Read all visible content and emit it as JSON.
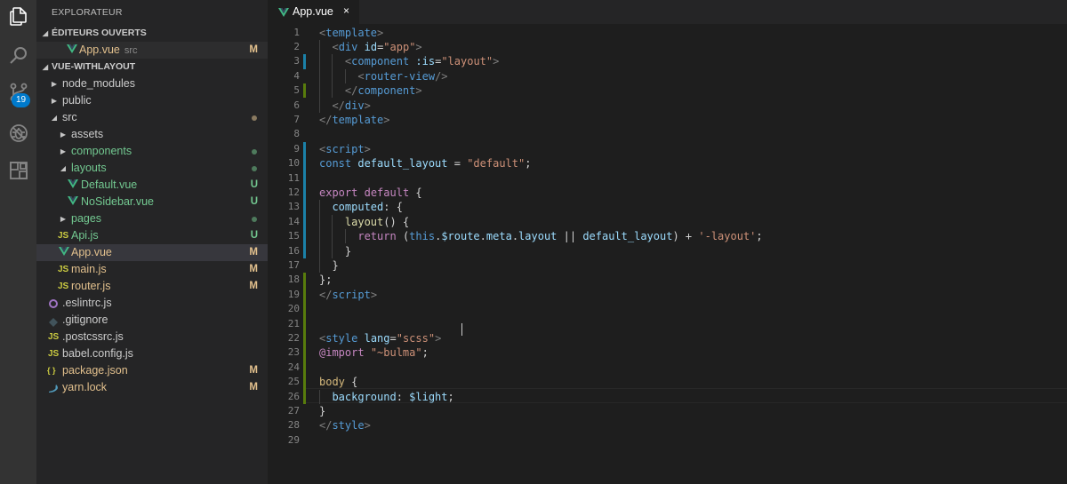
{
  "activity_bar": {
    "items": [
      {
        "name": "explorer-icon"
      },
      {
        "name": "search-icon"
      },
      {
        "name": "source-control-icon",
        "badge": "19"
      },
      {
        "name": "debug-icon"
      },
      {
        "name": "extensions-icon"
      }
    ],
    "active_color": "#ffffff",
    "inactive_color": "#858585"
  },
  "sidebar": {
    "title": "EXPLORATEUR",
    "open_editors": {
      "header": "ÉDITEURS OUVERTS",
      "items": [
        {
          "label": "App.vue",
          "description": "src",
          "status": "M"
        }
      ]
    },
    "project": {
      "header": "VUE-WITHLAYOUT",
      "items": [
        {
          "label": "node_modules",
          "kind": "folder",
          "expanded": false
        },
        {
          "label": "public",
          "kind": "folder",
          "expanded": false
        },
        {
          "label": "src",
          "kind": "folder",
          "expanded": true
        },
        {
          "label": "assets",
          "kind": "folder",
          "expanded": false
        },
        {
          "label": "components",
          "kind": "folder",
          "expanded": false
        },
        {
          "label": "layouts",
          "kind": "folder",
          "expanded": true
        },
        {
          "label": "Default.vue",
          "kind": "vue",
          "status": "U"
        },
        {
          "label": "NoSidebar.vue",
          "kind": "vue",
          "status": "U"
        },
        {
          "label": "pages",
          "kind": "folder",
          "expanded": false
        },
        {
          "label": "Api.js",
          "kind": "js",
          "icon_text": "JS",
          "status": "U"
        },
        {
          "label": "App.vue",
          "kind": "vue",
          "status": "M",
          "selected": true
        },
        {
          "label": "main.js",
          "kind": "js",
          "icon_text": "JS",
          "status": "M"
        },
        {
          "label": "router.js",
          "kind": "js",
          "icon_text": "JS",
          "status": "M"
        },
        {
          "label": ".eslintrc.js",
          "kind": "eslint"
        },
        {
          "label": ".gitignore",
          "kind": "git"
        },
        {
          "label": ".postcssrc.js",
          "kind": "js",
          "icon_text": "JS"
        },
        {
          "label": "babel.config.js",
          "kind": "js",
          "icon_text": "JS"
        },
        {
          "label": "package.json",
          "kind": "json",
          "icon_text": "{ }",
          "status": "M"
        },
        {
          "label": "yarn.lock",
          "kind": "yarn",
          "status": "M"
        }
      ]
    },
    "colors": {
      "modified": "#e2c08d",
      "untracked": "#73c991",
      "modified_dot": "#8a7a60",
      "untracked_dot": "#4e7a5c",
      "vue_green": "#41b883"
    }
  },
  "editor": {
    "tab": {
      "label": "App.vue",
      "close": "×"
    },
    "line_numbers": [
      "1",
      "2",
      "3",
      "4",
      "5",
      "6",
      "7",
      "8",
      "9",
      "10",
      "11",
      "12",
      "13",
      "14",
      "15",
      "16",
      "17",
      "18",
      "19",
      "20",
      "21",
      "22",
      "23",
      "24",
      "25",
      "26",
      "27",
      "28",
      "29"
    ],
    "lines": [
      [
        [
          "t-br",
          "<"
        ],
        [
          "t-tag",
          "template"
        ],
        [
          "t-br",
          ">"
        ]
      ],
      [
        [
          "t-pl",
          "  "
        ],
        [
          "t-br",
          "<"
        ],
        [
          "t-tag",
          "div"
        ],
        [
          "t-pl",
          " "
        ],
        [
          "t-attr",
          "id"
        ],
        [
          "t-pl",
          "="
        ],
        [
          "t-str",
          "\"app\""
        ],
        [
          "t-br",
          ">"
        ]
      ],
      [
        [
          "t-pl",
          "    "
        ],
        [
          "t-br",
          "<"
        ],
        [
          "t-tag",
          "component"
        ],
        [
          "t-pl",
          " "
        ],
        [
          "t-attr",
          ":is"
        ],
        [
          "t-pl",
          "="
        ],
        [
          "t-str",
          "\"layout\""
        ],
        [
          "t-br",
          ">"
        ]
      ],
      [
        [
          "t-pl",
          "      "
        ],
        [
          "t-br",
          "<"
        ],
        [
          "t-tag",
          "router-view"
        ],
        [
          "t-br",
          "/>"
        ]
      ],
      [
        [
          "t-pl",
          "    "
        ],
        [
          "t-br",
          "</"
        ],
        [
          "t-tag",
          "component"
        ],
        [
          "t-br",
          ">"
        ]
      ],
      [
        [
          "t-pl",
          "  "
        ],
        [
          "t-br",
          "</"
        ],
        [
          "t-tag",
          "div"
        ],
        [
          "t-br",
          ">"
        ]
      ],
      [
        [
          "t-br",
          "</"
        ],
        [
          "t-tag",
          "template"
        ],
        [
          "t-br",
          ">"
        ]
      ],
      [],
      [
        [
          "t-br",
          "<"
        ],
        [
          "t-tag",
          "script"
        ],
        [
          "t-br",
          ">"
        ]
      ],
      [
        [
          "t-kw2",
          "const"
        ],
        [
          "t-pl",
          " "
        ],
        [
          "t-var",
          "default_layout"
        ],
        [
          "t-pl",
          " = "
        ],
        [
          "t-str",
          "\"default\""
        ],
        [
          "t-pl",
          ";"
        ]
      ],
      [],
      [
        [
          "t-kw",
          "export"
        ],
        [
          "t-pl",
          " "
        ],
        [
          "t-kw",
          "default"
        ],
        [
          "t-pl",
          " {"
        ]
      ],
      [
        [
          "t-pl",
          "  "
        ],
        [
          "t-var",
          "computed"
        ],
        [
          "t-pl",
          ": {"
        ]
      ],
      [
        [
          "t-pl",
          "    "
        ],
        [
          "t-fn",
          "layout"
        ],
        [
          "t-pl",
          "() {"
        ]
      ],
      [
        [
          "t-pl",
          "      "
        ],
        [
          "t-kw",
          "return"
        ],
        [
          "t-pl",
          " ("
        ],
        [
          "t-kw2",
          "this"
        ],
        [
          "t-pl",
          "."
        ],
        [
          "t-var",
          "$route"
        ],
        [
          "t-pl",
          "."
        ],
        [
          "t-var",
          "meta"
        ],
        [
          "t-pl",
          "."
        ],
        [
          "t-var",
          "layout"
        ],
        [
          "t-pl",
          " || "
        ],
        [
          "t-var",
          "default_layout"
        ],
        [
          "t-pl",
          ") + "
        ],
        [
          "t-str",
          "'-layout'"
        ],
        [
          "t-pl",
          ";"
        ]
      ],
      [
        [
          "t-pl",
          "    }"
        ]
      ],
      [
        [
          "t-pl",
          "  }"
        ]
      ],
      [
        [
          "t-pl",
          "};"
        ]
      ],
      [
        [
          "t-br",
          "</"
        ],
        [
          "t-tag",
          "script"
        ],
        [
          "t-br",
          ">"
        ]
      ],
      [],
      [],
      [
        [
          "t-br",
          "<"
        ],
        [
          "t-tag",
          "style"
        ],
        [
          "t-pl",
          " "
        ],
        [
          "t-attr",
          "lang"
        ],
        [
          "t-pl",
          "="
        ],
        [
          "t-str",
          "\"scss\""
        ],
        [
          "t-br",
          ">"
        ]
      ],
      [
        [
          "t-kw",
          "@import"
        ],
        [
          "t-pl",
          " "
        ],
        [
          "t-str",
          "\"~bulma\""
        ],
        [
          "t-pl",
          ";"
        ]
      ],
      [],
      [
        [
          "t-sel",
          "body"
        ],
        [
          "t-pl",
          " {"
        ]
      ],
      [
        [
          "t-pl",
          "  "
        ],
        [
          "t-attr",
          "background"
        ],
        [
          "t-pl",
          ": "
        ],
        [
          "t-var",
          "$light"
        ],
        [
          "t-pl",
          ";"
        ]
      ],
      [
        [
          "t-pl",
          "}"
        ]
      ],
      [
        [
          "t-br",
          "</"
        ],
        [
          "t-tag",
          "style"
        ],
        [
          "t-br",
          ">"
        ]
      ],
      []
    ],
    "gutter_colors": {
      "modified": "#1b81a8",
      "added": "#587c0c"
    }
  }
}
